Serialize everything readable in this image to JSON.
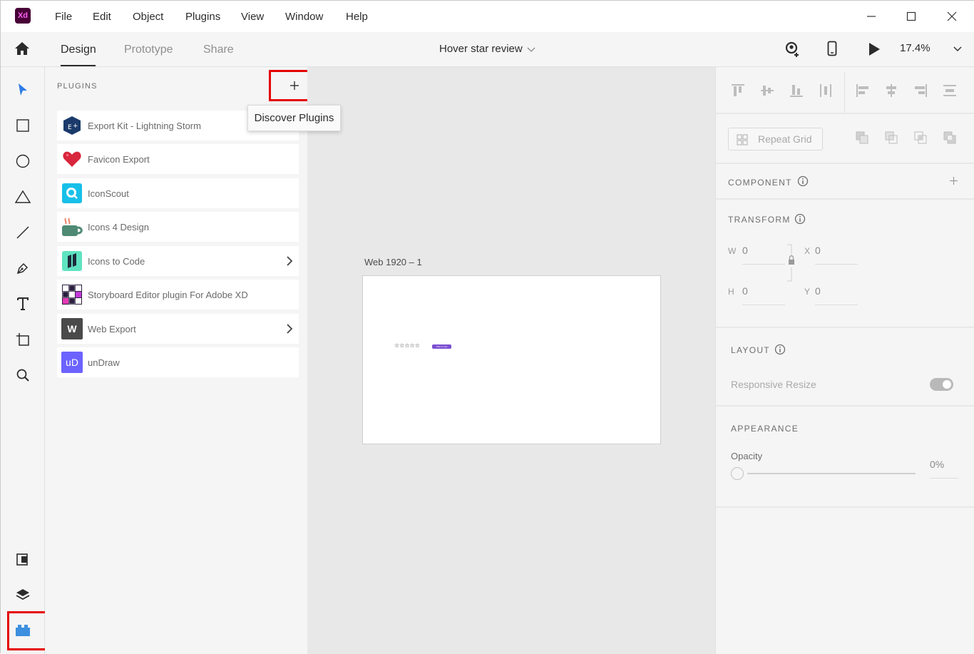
{
  "app": {
    "logo_text": "Xd",
    "accent": "#470137",
    "highlight": "#e50000"
  },
  "menu": {
    "items": [
      "File",
      "Edit",
      "Object",
      "Plugins",
      "View",
      "Window",
      "Help"
    ]
  },
  "tabs": {
    "design": "Design",
    "prototype": "Prototype",
    "share": "Share"
  },
  "document": {
    "title": "Hover star review"
  },
  "zoom": {
    "value": "17.4%"
  },
  "toolbar": {
    "tools": [
      "select-tool",
      "rectangle-tool",
      "ellipse-tool",
      "polygon-tool",
      "line-tool",
      "pen-tool",
      "text-tool",
      "artboard-tool",
      "zoom-tool"
    ],
    "bottom": [
      "assets-panel",
      "layers-panel",
      "plugins-panel"
    ]
  },
  "plugins": {
    "heading": "PLUGINS",
    "tooltip": "Discover Plugins",
    "items": [
      {
        "label": "Export Kit - Lightning Storm",
        "icon": "export-kit-icon",
        "chevron": false
      },
      {
        "label": "Favicon Export",
        "icon": "heart-icon",
        "chevron": false
      },
      {
        "label": "IconScout",
        "icon": "iconscout-icon",
        "chevron": false
      },
      {
        "label": "Icons 4 Design",
        "icon": "coffee-cup-icon",
        "chevron": false
      },
      {
        "label": "Icons to Code",
        "icon": "icons-to-code-icon",
        "chevron": true
      },
      {
        "label": "Storyboard Editor plugin For Adobe XD",
        "icon": "storyboard-icon",
        "chevron": false
      },
      {
        "label": "Web Export",
        "icon": "web-export-icon",
        "icon_text": "W",
        "chevron": true
      },
      {
        "label": "unDraw",
        "icon": "undraw-icon",
        "icon_text": "uD",
        "chevron": false
      }
    ]
  },
  "canvas": {
    "artboard_label": "Web 1920 – 1",
    "stars": "☆☆☆☆☆",
    "pill_text": "Click to rate"
  },
  "inspector": {
    "repeat_grid": "Repeat Grid",
    "component": "COMPONENT",
    "transform": "TRANSFORM",
    "w_label": "W",
    "w_value": "0",
    "x_label": "X",
    "x_value": "0",
    "h_label": "H",
    "h_value": "0",
    "y_label": "Y",
    "y_value": "0",
    "layout": "LAYOUT",
    "responsive_resize": "Responsive Resize",
    "responsive_resize_on": true,
    "appearance": "APPEARANCE",
    "opacity_label": "Opacity",
    "opacity_value": "0%",
    "opacity_level": 0
  }
}
